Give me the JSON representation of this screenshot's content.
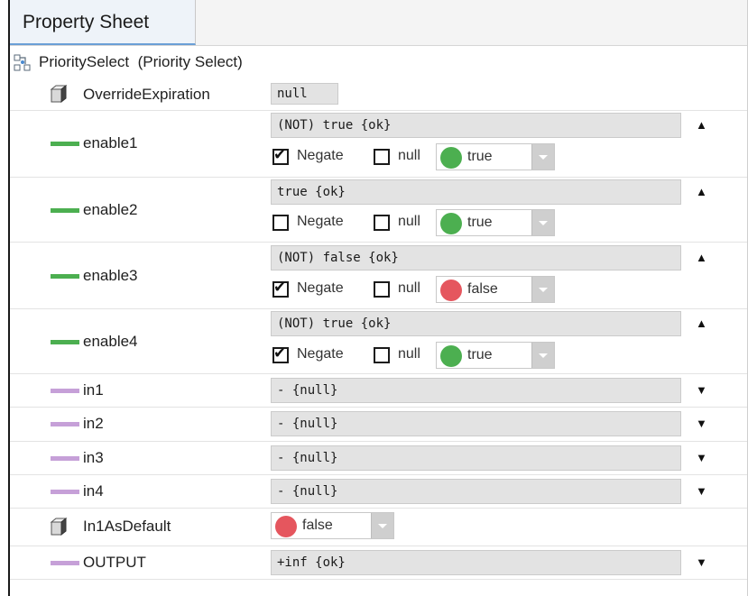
{
  "tab": {
    "label": "Property Sheet"
  },
  "component": {
    "name": "PrioritySelect",
    "type": "(Priority Select)"
  },
  "override_expiration": {
    "name": "OverrideExpiration",
    "value": "null"
  },
  "enables": [
    {
      "name": "enable1",
      "value": "(NOT) true {ok}",
      "negate_label": "Negate",
      "negate_checked": true,
      "null_label": "null",
      "null_checked": false,
      "state": "true",
      "state_color": "#4caf50"
    },
    {
      "name": "enable2",
      "value": "true {ok}",
      "negate_label": "Negate",
      "negate_checked": false,
      "null_label": "null",
      "null_checked": false,
      "state": "true",
      "state_color": "#4caf50"
    },
    {
      "name": "enable3",
      "value": "(NOT) false {ok}",
      "negate_label": "Negate",
      "negate_checked": true,
      "null_label": "null",
      "null_checked": false,
      "state": "false",
      "state_color": "#e5565e"
    },
    {
      "name": "enable4",
      "value": "(NOT) true {ok}",
      "negate_label": "Negate",
      "negate_checked": true,
      "null_label": "null",
      "null_checked": false,
      "state": "true",
      "state_color": "#4caf50"
    }
  ],
  "inputs": [
    {
      "name": "in1",
      "value": "- {null}"
    },
    {
      "name": "in2",
      "value": "- {null}"
    },
    {
      "name": "in3",
      "value": "- {null}"
    },
    {
      "name": "in4",
      "value": "- {null}"
    }
  ],
  "in1_as_default": {
    "name": "In1AsDefault",
    "state": "false",
    "state_color": "#e5565e"
  },
  "output": {
    "name": "OUTPUT",
    "value": "+inf {ok}"
  },
  "colors": {
    "enable_bar": "#4caf50",
    "input_bar": "#c6a0d8",
    "tab_underline": "#6a9fd6"
  },
  "icons": {
    "collapse": "collapse-up-icon",
    "expand": "expand-down-icon",
    "component": "priority-select-icon",
    "property": "property-cube-icon"
  }
}
